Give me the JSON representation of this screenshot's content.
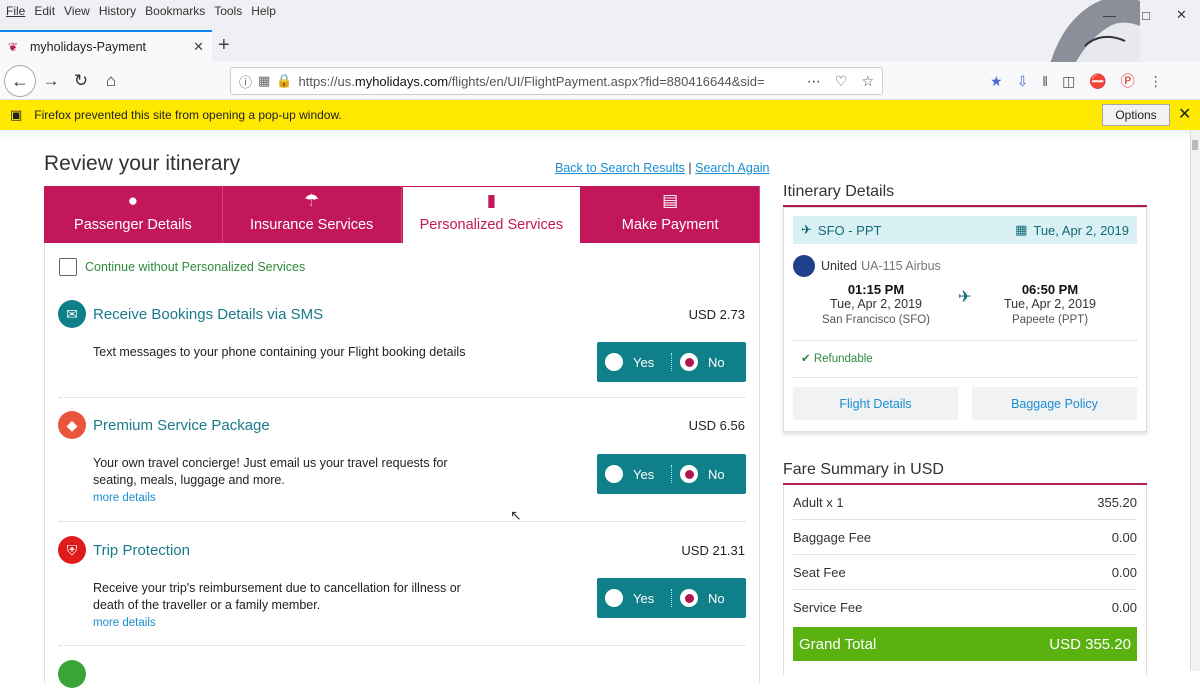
{
  "menu": [
    "File",
    "Edit",
    "View",
    "History",
    "Bookmarks",
    "Tools",
    "Help"
  ],
  "tab": {
    "title": "myholidays-Payment"
  },
  "url": {
    "prefix": "https://us.",
    "domain": "myholidays.com",
    "path": "/flights/en/UI/FlightPayment.aspx?fid=880416644&sid="
  },
  "notification": {
    "message": "Firefox prevented this site from opening a pop-up window.",
    "options": "Options"
  },
  "page": {
    "title": "Review your itinerary",
    "back_link": "Back to Search Results",
    "link_sep": "|",
    "search_again": "Search Again"
  },
  "steps": [
    {
      "label": "Passenger Details"
    },
    {
      "label": "Insurance Services"
    },
    {
      "label": "Personalized Services"
    },
    {
      "label": "Make Payment"
    }
  ],
  "continue_without": "Continue without Personalized Services",
  "services": [
    {
      "title": "Receive Bookings Details via SMS",
      "price": "USD 2.73",
      "desc": "Text messages to your phone containing your Flight booking details",
      "more": "",
      "color": "#0f7f89",
      "selected": "No"
    },
    {
      "title": "Premium Service Package",
      "price": "USD 6.56",
      "desc": "Your own travel concierge! Just email us your travel requests for seating, meals, luggage and more.",
      "more": "more details",
      "color": "#e8553a",
      "selected": "No"
    },
    {
      "title": "Trip Protection",
      "price": "USD 21.31",
      "desc": "Receive your trip's reimbursement due to cancellation for illness or death of the traveller or a family member.",
      "more": "more details",
      "color": "#e01b1b",
      "selected": "No"
    }
  ],
  "toggle": {
    "yes": "Yes",
    "no": "No"
  },
  "itinerary": {
    "header": "Itinerary Details",
    "route": "SFO - PPT",
    "date": "Tue, Apr 2, 2019",
    "airline": "United",
    "flight": "UA-115 Airbus",
    "depart": {
      "time": "01:15 PM",
      "date": "Tue, Apr 2, 2019",
      "city": "San Francisco (SFO)"
    },
    "arrive": {
      "time": "06:50 PM",
      "date": "Tue, Apr 2, 2019",
      "city": "Papeete (PPT)"
    },
    "refundable": "Refundable",
    "flight_details": "Flight Details",
    "baggage_policy": "Baggage Policy"
  },
  "fare": {
    "header": "Fare Summary in USD",
    "rows": [
      {
        "label": "Adult x 1",
        "value": "355.20"
      },
      {
        "label": "Baggage Fee",
        "value": "0.00"
      },
      {
        "label": "Seat Fee",
        "value": "0.00"
      },
      {
        "label": "Service Fee",
        "value": "0.00"
      }
    ],
    "grand_label": "Grand Total",
    "grand_value": "USD 355.20"
  }
}
